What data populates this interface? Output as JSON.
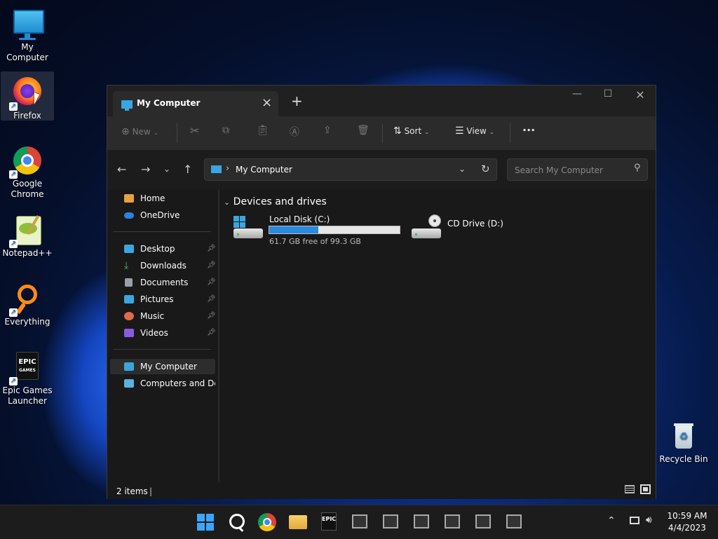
{
  "desktop": {
    "icons": [
      {
        "label": "My Computer"
      },
      {
        "label": "Firefox"
      },
      {
        "label": "Google Chrome"
      },
      {
        "label": "Notepad++"
      },
      {
        "label": "Everything"
      },
      {
        "label": "Epic Games Launcher"
      },
      {
        "label": "Recycle Bin"
      }
    ]
  },
  "window": {
    "tab_title": "My Computer",
    "toolbar": {
      "new_label": "New",
      "sort_label": "Sort",
      "view_label": "View",
      "more_label": "···"
    },
    "address": {
      "location": "My Computer",
      "search_placeholder": "Search My Computer"
    },
    "nav": {
      "quick": [
        {
          "label": "Home",
          "color": "#e8a040"
        },
        {
          "label": "OneDrive",
          "color": "#2d7fe0"
        }
      ],
      "pinned": [
        {
          "label": "Desktop",
          "color": "#3aa6e0"
        },
        {
          "label": "Downloads",
          "color": "#3bbf6e"
        },
        {
          "label": "Documents",
          "color": "#9aa0a6"
        },
        {
          "label": "Pictures",
          "color": "#3aa6e0"
        },
        {
          "label": "Music",
          "color": "#e06a4a"
        },
        {
          "label": "Videos",
          "color": "#8a5ae0"
        }
      ],
      "computer": [
        {
          "label": "My Computer",
          "color": "#3aa6e0"
        },
        {
          "label": "Computers and Devices",
          "color": "#5ab0e0"
        }
      ]
    },
    "content": {
      "group_label": "Devices and drives",
      "drives": [
        {
          "name": "Local Disk (C:)",
          "free_text": "61.7 GB free of 99.3 GB",
          "used_fraction": 0.379
        },
        {
          "name": "CD Drive (D:)"
        }
      ]
    },
    "status": {
      "items": "2 items"
    }
  },
  "taskbar": {
    "time": "10:59 AM",
    "date": "4/4/2023"
  }
}
